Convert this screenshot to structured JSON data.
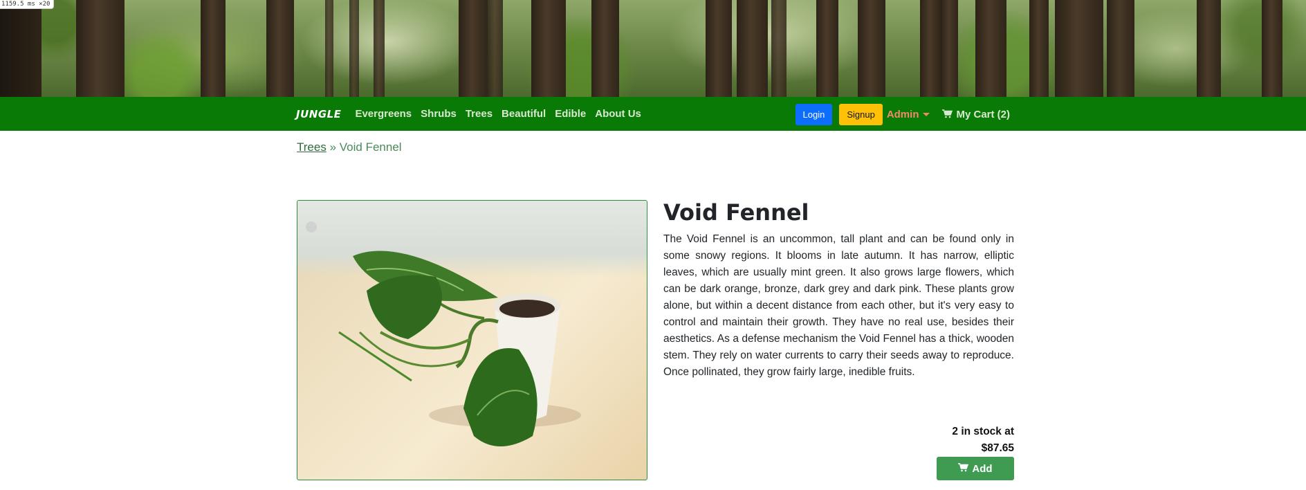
{
  "debug_badge": "1159.5 ms ×20",
  "navbar": {
    "brand": "JUNGLE",
    "links": [
      "Evergreens",
      "Shrubs",
      "Trees",
      "Beautiful",
      "Edible",
      "About Us"
    ],
    "login_label": "Login",
    "signup_label": "Signup",
    "admin_label": "Admin",
    "cart_label": "My Cart (2)",
    "icons": {
      "cart": "cart-icon",
      "admin_dropdown": "caret-down-icon"
    }
  },
  "breadcrumb": {
    "parent": "Trees",
    "separator": "»",
    "current": "Void Fennel"
  },
  "product": {
    "name": "Void Fennel",
    "description": "The Void Fennel is an uncommon, tall plant and can be found only in some snowy regions. It blooms in late autumn. It has narrow, elliptic leaves, which are usually mint green. It also grows large flowers, which can be dark orange, bronze, dark grey and dark pink. These plants grow alone, but within a decent distance from each other, but it's very easy to control and maintain their growth. They have no real use, besides their aesthetics. As a defense mechanism the Void Fennel has a thick, wooden stem. They rely on water currents to carry their seeds away to reproduce. Once pollinated, they grow fairly large, inedible fruits.",
    "stock_text": "2 in stock at",
    "price": "$87.65",
    "add_label": "Add"
  },
  "colors": {
    "navbar": "#097a05",
    "login": "#0d6efd",
    "signup": "#ffc107",
    "admin": "#f08a6a",
    "add_button": "#3f9b52"
  }
}
